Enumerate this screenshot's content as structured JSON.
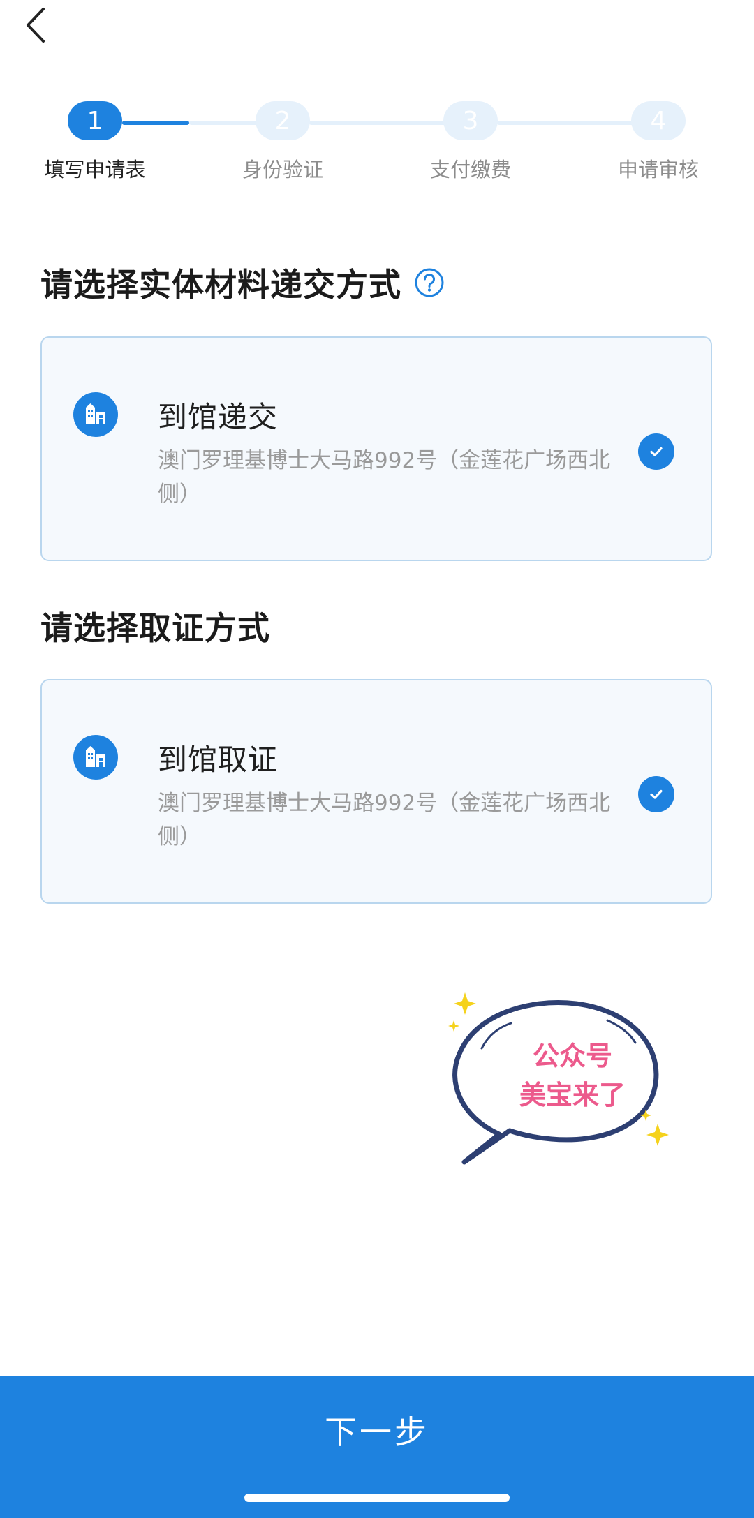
{
  "colors": {
    "primary": "#1e82df",
    "inactive_step": "#e6f1fb",
    "card_border": "#b9d6ee",
    "card_background": "#f5f9fd",
    "sticker_text": "#ec5a8c"
  },
  "header": {
    "back_icon": "chevron-left-icon"
  },
  "stepper": {
    "current_step": 1,
    "steps": [
      {
        "number": "1",
        "label": "填写申请表"
      },
      {
        "number": "2",
        "label": "身份验证"
      },
      {
        "number": "3",
        "label": "支付缴费"
      },
      {
        "number": "4",
        "label": "申请审核"
      }
    ]
  },
  "submission": {
    "title": "请选择实体材料递交方式",
    "help_icon": "question-circle-icon",
    "option": {
      "title": "到馆递交",
      "address": "澳门罗理基博士大马路992号（金莲花广场西北侧）",
      "selected": true,
      "icon": "building-icon"
    }
  },
  "pickup": {
    "title": "请选择取证方式",
    "option": {
      "title": "到馆取证",
      "address": "澳门罗理基博士大马路992号（金莲花广场西北侧）",
      "selected": true,
      "icon": "building-icon"
    }
  },
  "sticker": {
    "line1": "公众号",
    "line2": "美宝来了"
  },
  "footer": {
    "next_label": "下一步"
  }
}
